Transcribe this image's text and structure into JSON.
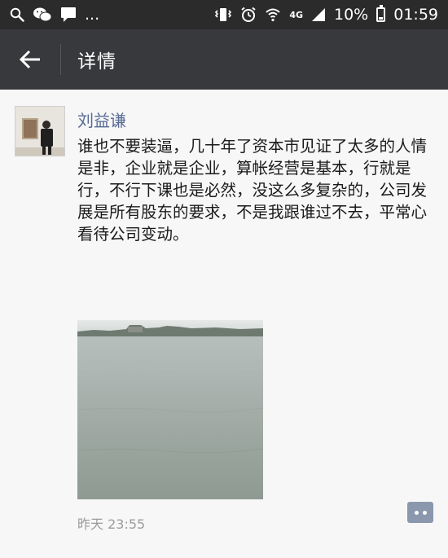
{
  "status_bar": {
    "ellipsis": "...",
    "network": "4G",
    "battery": "10%",
    "time": "01:59"
  },
  "header": {
    "title": "详情"
  },
  "post": {
    "author": "刘益谦",
    "text": "谁也不要装逼，几十年了资本市见证了太多的人情是非，企业就是企业，算帐经营是基本，行就是行，不行下课也是必然，没这么多复杂的，公司发展是所有股东的要求，不是我跟谁过不去，平常心看待公司变动。",
    "timestamp": "昨天 23:55"
  },
  "icons": {
    "back": "arrow-left-icon",
    "comment": "more-dots-icon"
  },
  "colors": {
    "status_bar": "#2b2b2b",
    "title_bar": "#37393c",
    "author_link": "#576b95",
    "comment_button": "#8a97ad"
  }
}
